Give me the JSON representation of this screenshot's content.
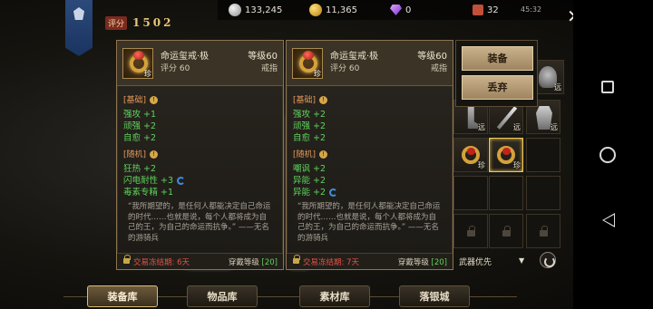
{
  "status": {
    "time": "45:32"
  },
  "currencies": [
    {
      "icon": "silver-coin-icon",
      "value": "133,245"
    },
    {
      "icon": "gold-coin-icon",
      "value": "11,365"
    },
    {
      "icon": "diamond-icon",
      "value": "0"
    },
    {
      "icon": "inventory-bag-icon",
      "value": "32"
    }
  ],
  "score": {
    "label": "评分",
    "value": "1502"
  },
  "cards": [
    {
      "name": "命运玺戒·极",
      "level": "等级60",
      "score": "评分 60",
      "type": "戒指",
      "icon_badge": "珍",
      "basic_title": "[基础]",
      "basic_stats": [
        "强攻 +1",
        "顽强 +2",
        "自愈 +2"
      ],
      "random_title": "[随机]",
      "random_stats": [
        "狂热 +2",
        "闪电耐性 +3",
        "毒素专精 +1"
      ],
      "quote": "“我所期望的，是任何人都能决定自己命运的时代……也就是说，每个人都将成为自己的王，为自己的命运而抗争。” ——无名的游骑兵",
      "trade_lock": "交易冻结期: 6天",
      "wear_label": "穿戴等级",
      "wear_level": "[20]"
    },
    {
      "name": "命运玺戒·极",
      "level": "等级60",
      "score": "评分 60",
      "type": "戒指",
      "icon_badge": "珍",
      "basic_title": "[基础]",
      "basic_stats": [
        "强攻 +2",
        "顽强 +2",
        "自愈 +2"
      ],
      "random_title": "[随机]",
      "random_stats": [
        "嘲讽 +2",
        "异能 +2",
        "异能 +2"
      ],
      "quote": "“我所期望的，是任何人都能决定自己命运的时代……也就是说，每个人都将成为自己的王，为自己的命运而抗争。” ——无名的游骑兵",
      "trade_lock": "交易冻结期: 7天",
      "wear_label": "穿戴等级",
      "wear_level": "[20]"
    }
  ],
  "menu": {
    "equip": "装备",
    "discard": "丢弃"
  },
  "inventory": {
    "badges": {
      "yuan": "远",
      "zhen": "珍"
    },
    "sort_label": "武器优先"
  },
  "tabs": [
    "装备库",
    "物品库",
    "素材库",
    "落银城"
  ],
  "accent": {
    "gold": "#d4a23a",
    "green": "#5ed35c",
    "red": "#e0534a",
    "orange": "#e59a5c"
  }
}
